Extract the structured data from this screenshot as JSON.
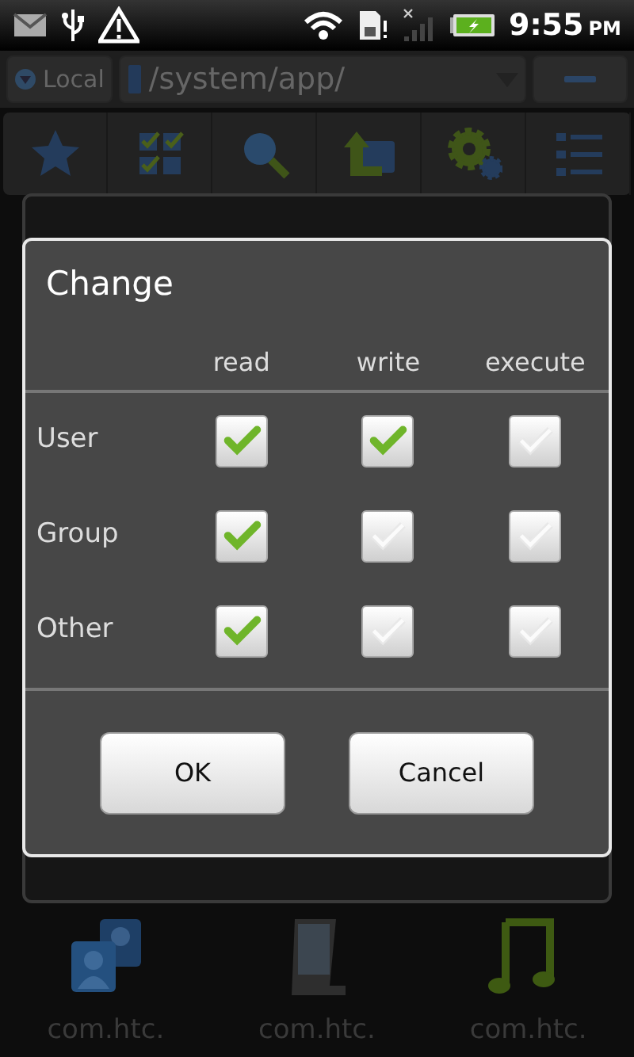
{
  "status_bar": {
    "time": "9:55",
    "meridiem": "PM"
  },
  "path_bar": {
    "location_button": "Local",
    "path": "/system/app/"
  },
  "toolbar": {
    "buttons": [
      {
        "kind": "favorites"
      },
      {
        "kind": "select"
      },
      {
        "kind": "search"
      },
      {
        "kind": "up"
      },
      {
        "kind": "settings"
      },
      {
        "kind": "list"
      }
    ]
  },
  "change_dialog": {
    "title": "Change",
    "columns": [
      "read",
      "write",
      "execute"
    ],
    "rows": [
      {
        "label": "User",
        "permissions": [
          {
            "checked": true
          },
          {
            "checked": true
          },
          {
            "checked": false
          }
        ]
      },
      {
        "label": "Group",
        "permissions": [
          {
            "checked": true
          },
          {
            "checked": false
          },
          {
            "checked": false
          }
        ]
      },
      {
        "label": "Other",
        "permissions": [
          {
            "checked": true
          },
          {
            "checked": false
          },
          {
            "checked": false
          }
        ]
      }
    ],
    "buttons": [
      "OK",
      "Cancel"
    ]
  },
  "files": [
    {
      "kind": "contacts",
      "label": "com.htc."
    },
    {
      "kind": "note",
      "label": "com.htc."
    },
    {
      "kind": "music",
      "label": "com.htc."
    }
  ]
}
